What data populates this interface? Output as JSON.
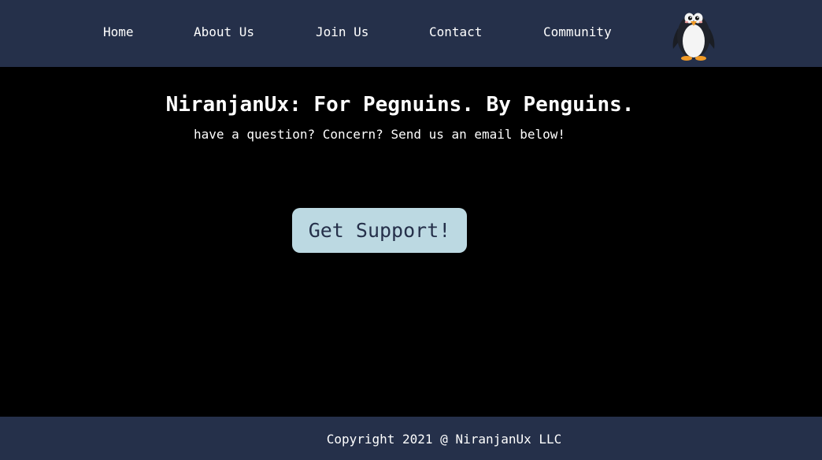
{
  "nav": {
    "items": [
      {
        "label": "Home"
      },
      {
        "label": "About Us"
      },
      {
        "label": "Join Us"
      },
      {
        "label": "Contact"
      },
      {
        "label": "Community"
      }
    ],
    "logo_icon": "penguin-icon"
  },
  "hero": {
    "title": "NiranjanUx: For Pegnuins. By Penguins.",
    "subtitle": "have a question? Concern? Send us an email below!"
  },
  "support": {
    "button_label": "Get Support!"
  },
  "footer": {
    "copyright": "Copyright 2021 @ NiranjanUx LLC"
  },
  "colors": {
    "nav_background": "#25304a",
    "page_background": "#000000",
    "button_background": "#bcd9e2",
    "button_text": "#25304a",
    "text": "#ffffff"
  }
}
